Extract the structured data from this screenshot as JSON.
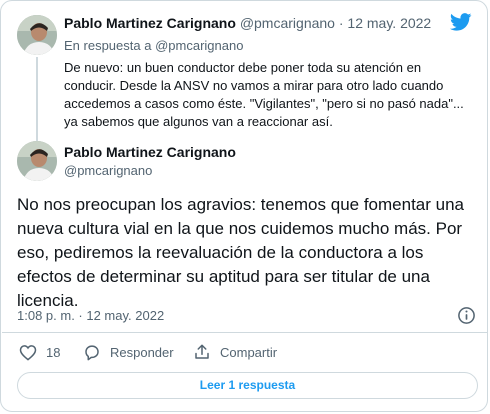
{
  "reply_tweet": {
    "author_name": "Pablo Martinez Carignano",
    "handle": "@pmcarignano",
    "separator": "·",
    "date": "12 may. 2022",
    "reply_prefix": "En respuesta a",
    "reply_to": "@pmcarignano",
    "text": "De nuevo: un buen conductor debe poner toda su atención en conducir. Desde la ANSV no vamos a mirar para otro lado cuando accedemos a casos como éste. \"Vigilantes\", \"pero si no pasó nada\"... ya sabemos que algunos van a reaccionar así."
  },
  "main_tweet": {
    "author_name": "Pablo Martinez Carignano",
    "handle": "@pmcarignano",
    "text": "No nos preocupan los agravios: tenemos que fomentar una nueva cultura vial en la que nos cuidemos mucho más. Por eso, pediremos la reevaluación de la conductora a los efectos de determinar su aptitud para ser titular de una licencia.",
    "timestamp": "1:08 p. m. · 12 may. 2022"
  },
  "actions": {
    "like_count": "18",
    "reply_label": "Responder",
    "share_label": "Compartir"
  },
  "read_replies_label": "Leer 1 respuesta",
  "icons": {
    "brand": "twitter-bird-icon",
    "info": "info-icon",
    "like": "heart-icon",
    "reply": "speech-bubble-icon",
    "share": "share-icon"
  },
  "colors": {
    "accent": "#1d9bf0",
    "muted_text": "#536471",
    "border": "#cfd9de"
  }
}
